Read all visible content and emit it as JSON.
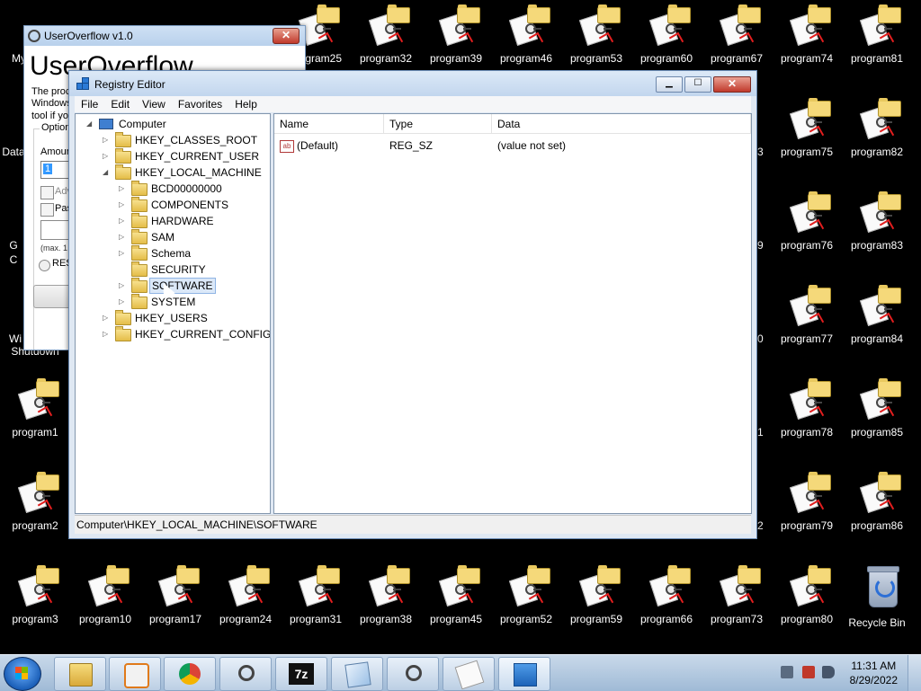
{
  "desktop": {
    "icons_top_row": [
      "program25",
      "program32",
      "program39",
      "program46",
      "program53",
      "program60",
      "program67",
      "program74",
      "program81"
    ],
    "icons_right_col1": [
      "program75",
      "program76",
      "program77",
      "program78",
      "program79",
      "program80"
    ],
    "icons_right_col2": [
      "program82",
      "program83",
      "program84",
      "program85",
      "program86"
    ],
    "icons_bottom_row": [
      "program3",
      "program10",
      "program17",
      "program24",
      "program31",
      "program38",
      "program45",
      "program52",
      "program59",
      "program66",
      "program73"
    ],
    "icons_left_col": [
      "program1",
      "program2"
    ],
    "left_partial": [
      "My C",
      "Data",
      "G",
      "C",
      "Wi",
      "Shutdown"
    ],
    "recycle_bin": "Recycle Bin",
    "hidden_edge_labels": [
      "3",
      "9",
      "0",
      "1",
      "2"
    ]
  },
  "useroverflow": {
    "title": "UserOverflow v1.0",
    "heading": "UserOverflow",
    "desc_line1": "The proc",
    "desc_line2": "Windows",
    "desc_line3": "tool if yo",
    "group_label": "Option",
    "amount_label": "Amour",
    "amount_value": "1",
    "check1_label": "Adv",
    "check2_label": "Pas",
    "max_note": "(max. 1",
    "radio_label": "RES",
    "close_glyph": "✕"
  },
  "registry": {
    "title": "Registry Editor",
    "window_buttons": {
      "minimize": "▁",
      "maximize": "☐",
      "close": "✕"
    },
    "menu": [
      "File",
      "Edit",
      "View",
      "Favorites",
      "Help"
    ],
    "tree": {
      "root": "Computer",
      "hives": [
        "HKEY_CLASSES_ROOT",
        "HKEY_CURRENT_USER",
        "HKEY_LOCAL_MACHINE"
      ],
      "hklm_children": [
        "BCD00000000",
        "COMPONENTS",
        "HARDWARE",
        "SAM",
        "Schema",
        "SECURITY",
        "SOFTWARE",
        "SYSTEM"
      ],
      "hives_after": [
        "HKEY_USERS",
        "HKEY_CURRENT_CONFIG"
      ],
      "selected": "SOFTWARE"
    },
    "columns": [
      "Name",
      "Type",
      "Data"
    ],
    "rows": [
      {
        "name": "(Default)",
        "type": "REG_SZ",
        "data": "(value not set)",
        "icon": "ab"
      }
    ],
    "status_path": "Computer\\HKEY_LOCAL_MACHINE\\SOFTWARE"
  },
  "taskbar": {
    "pinned": [
      "explorer-icon",
      "media-player-icon",
      "chrome-icon",
      "keys-app-icon",
      "7zip-icon",
      "notepad-icon",
      "keys-app-icon-2",
      "useroverflow-icon",
      "regedit-icon"
    ],
    "sevenzip_label": "7z",
    "time": "11:31 AM",
    "date": "8/29/2022"
  }
}
